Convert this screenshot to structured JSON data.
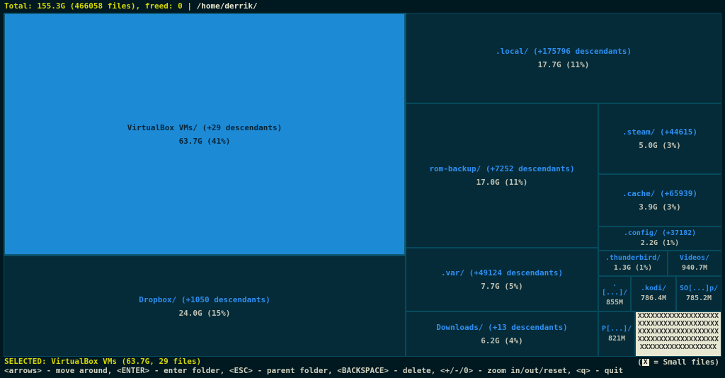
{
  "top": {
    "total_label": "Total:",
    "total_size": "155.3G",
    "file_count": "(466058 files)",
    "freed_label": ", freed:",
    "freed_value": "0",
    "sep": "|",
    "path": "/home/derrik/"
  },
  "cells": {
    "vbox": {
      "name": "VirtualBox VMs/ (+29 descendants)",
      "size": "63.7G (41%)"
    },
    "dropbox": {
      "name": "Dropbox/ (+1050 descendants)",
      "size": "24.0G (15%)"
    },
    "local": {
      "name": ".local/ (+175796 descendants)",
      "size": "17.7G (11%)"
    },
    "rom": {
      "name": "rom-backup/ (+7252 descendants)",
      "size": "17.0G (11%)"
    },
    "var": {
      "name": ".var/ (+49124 descendants)",
      "size": "7.7G (5%)"
    },
    "downloads": {
      "name": "Downloads/ (+13 descendants)",
      "size": "6.2G (4%)"
    },
    "steam": {
      "name": ".steam/ (+44615)",
      "size": "5.0G (3%)"
    },
    "cache": {
      "name": ".cache/ (+65939)",
      "size": "3.9G (3%)"
    },
    "config": {
      "name": ".config/ (+37182)",
      "size": "2.2G (1%)"
    },
    "thunder": {
      "name": ".thunderbird/",
      "size": "1.3G (1%)"
    },
    "videos": {
      "name": "Videos/",
      "size": "940.7M"
    },
    "dots": {
      "name": ".[...]/",
      "size": "855M"
    },
    "kodi": {
      "name": ".kodi/",
      "size": "786.4M"
    },
    "sop": {
      "name": "SO[...]p/",
      "size": "785.2M"
    },
    "p": {
      "name": "P[...]/",
      "size": "821M"
    }
  },
  "smallfiles_fill": "XXXXXXXXXXXXXXXXXXXXXXXXXXXXXXXXXXXXXXXXXXXXXXXXXXXXXXXXXXXXXXXXXXXXXXXXXXXXXXXXXXXXXXXXXXXXXX",
  "legend": {
    "text": " = Small files)",
    "box_char": "X"
  },
  "bottom": {
    "selected_label": "SELECTED:",
    "selected_value": "VirtualBox VMs (63.7G, 29 files)",
    "help": "<arrows> - move around, <ENTER> - enter folder, <ESC> - parent folder, <BACKSPACE> - delete, <+/-/0> - zoom in/out/reset, <q> - quit"
  },
  "chart_data": {
    "type": "treemap",
    "root": "/home/derrik/",
    "total_bytes_human": "155.3G",
    "total_files": 466058,
    "freed": 0,
    "selected": "VirtualBox VMs",
    "nodes": [
      {
        "name": "VirtualBox VMs",
        "size": "63.7G",
        "pct": 41,
        "descendants": 29
      },
      {
        "name": "Dropbox",
        "size": "24.0G",
        "pct": 15,
        "descendants": 1050
      },
      {
        "name": ".local",
        "size": "17.7G",
        "pct": 11,
        "descendants": 175796
      },
      {
        "name": "rom-backup",
        "size": "17.0G",
        "pct": 11,
        "descendants": 7252
      },
      {
        "name": ".var",
        "size": "7.7G",
        "pct": 5,
        "descendants": 49124
      },
      {
        "name": "Downloads",
        "size": "6.2G",
        "pct": 4,
        "descendants": 13
      },
      {
        "name": ".steam",
        "size": "5.0G",
        "pct": 3,
        "descendants": 44615
      },
      {
        "name": ".cache",
        "size": "3.9G",
        "pct": 3,
        "descendants": 65939
      },
      {
        "name": ".config",
        "size": "2.2G",
        "pct": 1,
        "descendants": 37182
      },
      {
        "name": ".thunderbird",
        "size": "1.3G",
        "pct": 1
      },
      {
        "name": "Videos",
        "size": "940.7M"
      },
      {
        "name": ".[...]",
        "size": "855M"
      },
      {
        "name": ".kodi",
        "size": "786.4M"
      },
      {
        "name": "SO[...]p",
        "size": "785.2M"
      },
      {
        "name": "P[...]",
        "size": "821M"
      }
    ]
  }
}
